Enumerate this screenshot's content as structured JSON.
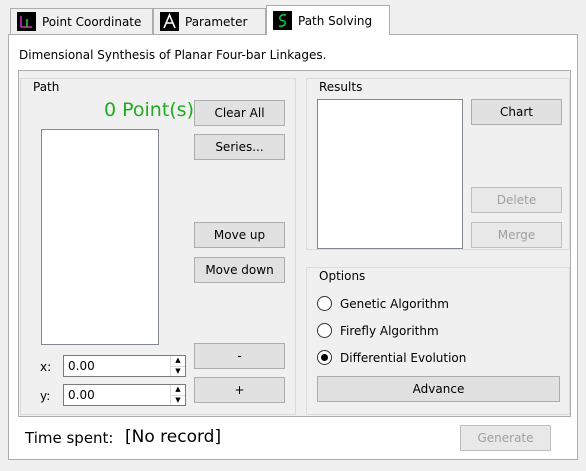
{
  "tabs": [
    {
      "label": "Point Coordinate",
      "icon": "point-coordinate-icon",
      "active": false
    },
    {
      "label": "Parameter",
      "icon": "parameter-icon",
      "active": false
    },
    {
      "label": "Path Solving",
      "icon": "path-solving-icon",
      "active": true
    }
  ],
  "subtitle": "Dimensional Synthesis of Planar Four-bar Linkages.",
  "path": {
    "title": "Path",
    "points_count": "0 Point(s)",
    "buttons": {
      "clear_all": "Clear All",
      "series": "Series...",
      "move_up": "Move up",
      "move_down": "Move down",
      "minus": "-",
      "plus": "+"
    },
    "x_label": "x:",
    "y_label": "y:",
    "x_value": "0.00",
    "y_value": "0.00"
  },
  "results": {
    "title": "Results",
    "buttons": {
      "chart": "Chart",
      "delete": "Delete",
      "merge": "Merge"
    }
  },
  "options": {
    "title": "Options",
    "algorithms": [
      {
        "label": "Genetic Algorithm",
        "checked": false
      },
      {
        "label": "Firefly Algorithm",
        "checked": false
      },
      {
        "label": "Differential Evolution",
        "checked": true
      }
    ],
    "advance_label": "Advance"
  },
  "footer": {
    "time_spent_label": "Time spent:",
    "time_spent_value": "[No record]",
    "generate_label": "Generate"
  },
  "colors": {
    "points_count": "#22aa22",
    "icon_accent": "#00cc44"
  }
}
